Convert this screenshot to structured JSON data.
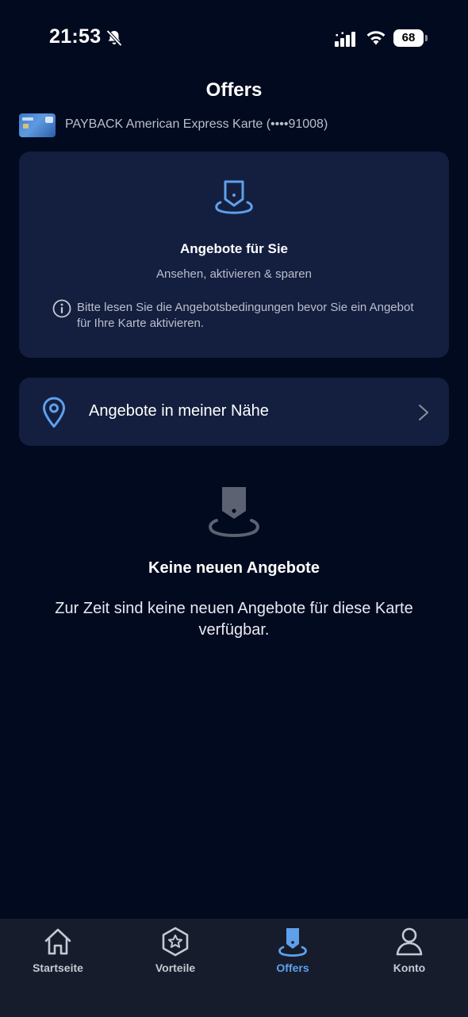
{
  "status_bar": {
    "time": "21:53",
    "battery": "68"
  },
  "header": {
    "title": "Offers"
  },
  "card": {
    "label": "PAYBACK American Express Karte (••••91008)"
  },
  "offers_card": {
    "title": "Angebote für Sie",
    "subtitle": "Ansehen, aktivieren & sparen",
    "info": "Bitte lesen Sie die Angebotsbedingungen bevor Sie ein Angebot für Ihre Karte aktivieren."
  },
  "nearby": {
    "label": "Angebote in meiner Nähe"
  },
  "empty_state": {
    "title": "Keine neuen Angebote",
    "description": "Zur Zeit sind keine neuen Angebote für diese Karte verfügbar."
  },
  "tabs": [
    {
      "label": "Startseite",
      "icon": "home-icon"
    },
    {
      "label": "Vorteile",
      "icon": "star-badge-icon"
    },
    {
      "label": "Offers",
      "icon": "offers-icon",
      "active": true
    },
    {
      "label": "Konto",
      "icon": "person-icon"
    }
  ],
  "colors": {
    "background": "#020a1f",
    "card": "#141f3f",
    "accent": "#5ea0ec",
    "tab_bar": "#171c2c",
    "muted_text": "#b9bfcc"
  }
}
